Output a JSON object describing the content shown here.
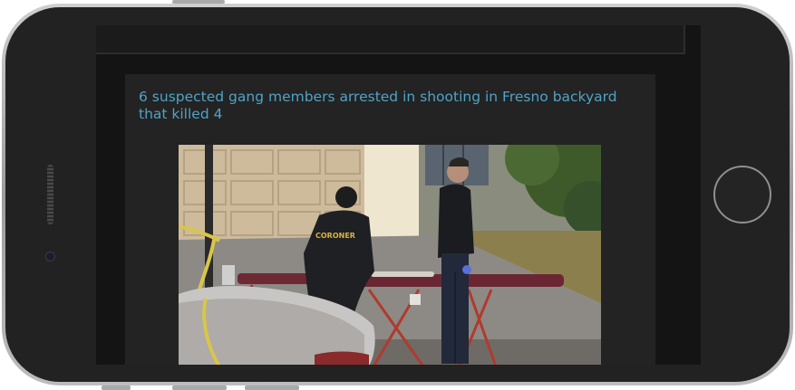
{
  "article": {
    "headline": "6 suspected gang members arrested in shooting in Fresno backyard that killed 4",
    "image": {
      "coroner_jacket_text": "CORONER"
    }
  }
}
